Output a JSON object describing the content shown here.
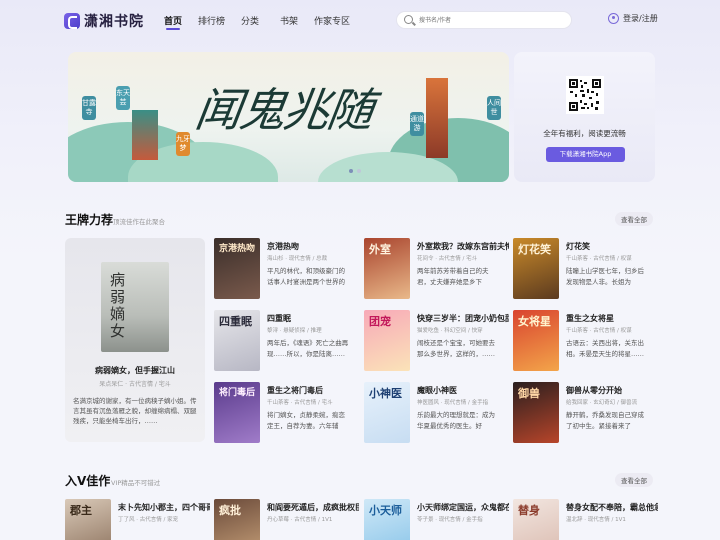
{
  "brand": {
    "name": "潇湘书院"
  },
  "nav": {
    "items": [
      "首页",
      "排行榜",
      "分类",
      "书架",
      "作家专区"
    ],
    "active": "首页"
  },
  "search": {
    "placeholder": "搜书名/作者"
  },
  "user": {
    "label": "登录/注册"
  },
  "banner": {
    "title": "闻鬼兆随",
    "tags": [
      "甘露寺",
      "东天芸",
      "九牙梦",
      "通道游",
      "人间世"
    ],
    "slides": 2,
    "active_slide": 1
  },
  "app": {
    "slogan": "全年有福利，阅读更流畅",
    "button": "下载潇湘书院App"
  },
  "section1": {
    "title": "王牌力荐",
    "subtitle": "顶流佳作在此聚合",
    "more": "查看全部",
    "featured": {
      "cover_text": "病弱嫡女",
      "title": "病弱嫡女，但手握江山",
      "meta": "呆点呆仁 · 古代言情 / 宅斗",
      "desc": "名满京城的谢家，有一位病秧子嫡小姐。传言其虽有沉鱼落雁之貌，却缠绵病榻、双腿残疾，只能坐椅车出行，……"
    },
    "books": [
      {
        "title": "京港热吻",
        "meta": "海山杉 · 现代言情 / 总裁",
        "desc": "平凡的林代，和顶级豪门的话事人时宴洲是两个世界的人，……",
        "cover_text": "京港热吻",
        "c1": "#3a2e2a",
        "c2": "#7a5a4c",
        "tc": "#ffe9c9"
      },
      {
        "title": "外室欺我？改嫁东宫前夫悔疯了",
        "meta": "花间令 · 古代言情 / 宅斗",
        "desc": "两年前苏芳带着自己的夫君，丈夫嫌弃她是乡下妇，……",
        "cover_text": "外室",
        "c1": "#a9442e",
        "c2": "#e9b98a",
        "tc": "#fff3df"
      },
      {
        "title": "灯花笑",
        "meta": "千山茶客 · 古代言情 / 权谋",
        "desc": "陆瞳上山学医七年，归乡后发现物是人非。长姐为人……",
        "cover_text": "灯花笑",
        "c1": "#c98a2a",
        "c2": "#5b3a1f",
        "tc": "#fff2d6"
      },
      {
        "title": "四重眠",
        "meta": "黎浔 · 悬疑侦探 / 推理",
        "desc": "两年后，《魂语》死亡之曲再现……所以，你是陆离……",
        "cover_text": "四重眠",
        "c1": "#e6e6ea",
        "c2": "#b7b7c4",
        "tc": "#2b2b3a"
      },
      {
        "title": "快穿三岁半：团宠小奶包甜又软",
        "meta": "猫爱吃鱼 · 科幻空间 / 快穿",
        "desc": "闹枝还是个宝宝，可她要去那么多世界，这样的，……",
        "cover_text": "团宠",
        "c1": "#f7a9b8",
        "c2": "#fbe3b8",
        "tc": "#c2185b"
      },
      {
        "title": "重生之女将星",
        "meta": "千山茶客 · 古代言情 / 权谋",
        "desc": "古语云：关西出将，关东出相。禾晏是天生的将星……",
        "cover_text": "女将星",
        "c1": "#d9442f",
        "c2": "#f3a54a",
        "tc": "#fff5d0"
      },
      {
        "title": "重生之将门毒后",
        "meta": "千山茶客 · 古代言情 / 宅斗",
        "desc": "将门嫡女，贞静柔婉，痴恋定王，自荐为妻。六年辅佐……",
        "cover_text": "将门毒后",
        "c1": "#5a3b8c",
        "c2": "#a07cc9",
        "tc": "#fff0ff"
      },
      {
        "title": "魔眼小神医",
        "meta": "神医圆风 · 现代言情 / 金手指",
        "desc": "乐韵最大的理想就是：成为华夏最优秀的医生。好运……",
        "cover_text": "小神医",
        "c1": "#e7f1fb",
        "c2": "#c7ddf2",
        "tc": "#1d3f72"
      },
      {
        "title": "御兽从零分开始",
        "meta": "给我回家 · 玄幻奇幻 / 御兽流",
        "desc": "静开鹤，乔桑发现自己穿成了初中生。紧接着来了一……",
        "cover_text": "御兽",
        "c1": "#2a1f1f",
        "c2": "#b8452a",
        "tc": "#ffd7a6"
      }
    ]
  },
  "section2": {
    "title": "入V佳作",
    "subtitle": "VIP精品不可错过",
    "more": "查看全部",
    "books": [
      {
        "title": "末卜先知小郡主，四个哥哥都宠我",
        "meta": "丁了风 · 古代言情 / 家宠",
        "desc": "",
        "cover_text": "郡主",
        "c1": "#d9c9b8",
        "c2": "#8a6f5a",
        "tc": "#3a2a1a"
      },
      {
        "title": "和阎要死遁后，成疯批权臣白月光",
        "meta": "丹心草莓 · 古代言情 / 1V1",
        "desc": "",
        "cover_text": "疯批",
        "c1": "#6a4a3a",
        "c2": "#c9a27a",
        "tc": "#fff0d8"
      },
      {
        "title": "小天师绑定国运，众鬼都在哭",
        "meta": "苓子景 · 现代言情 / 金手指",
        "desc": "",
        "cover_text": "小天师",
        "c1": "#cfe8f7",
        "c2": "#86c3e8",
        "tc": "#1b5d9a"
      },
      {
        "title": "替身女配不奉陪，霸总他急了",
        "meta": "温北辞 · 现代言情 / 1V1",
        "desc": "",
        "cover_text": "替身",
        "c1": "#f2e6e0",
        "c2": "#d9b9ad",
        "tc": "#8a3a2a"
      }
    ]
  }
}
